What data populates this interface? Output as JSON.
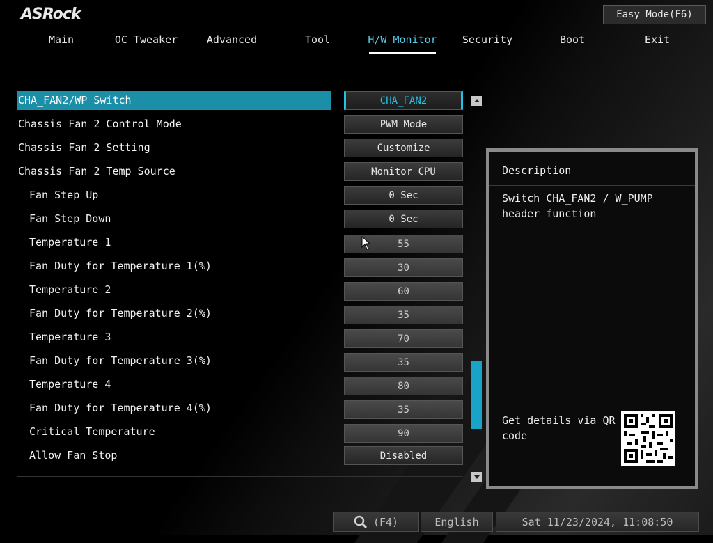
{
  "brand": {
    "logo": "ASRock"
  },
  "header": {
    "easy_mode_label": "Easy Mode(F6)"
  },
  "nav": {
    "tabs": [
      {
        "label": "Main"
      },
      {
        "label": "OC Tweaker"
      },
      {
        "label": "Advanced"
      },
      {
        "label": "Tool"
      },
      {
        "label": "H/W Monitor",
        "active": true
      },
      {
        "label": "Security"
      },
      {
        "label": "Boot"
      },
      {
        "label": "Exit"
      }
    ]
  },
  "settings": [
    {
      "label": "CHA_FAN2/WP Switch",
      "value": "CHA_FAN2",
      "selected": true
    },
    {
      "label": "Chassis Fan 2 Control Mode",
      "value": "PWM Mode"
    },
    {
      "label": "Chassis Fan 2 Setting",
      "value": "Customize"
    },
    {
      "label": "Chassis Fan 2 Temp Source",
      "value": "Monitor CPU"
    },
    {
      "label": "Fan Step Up",
      "value": "0 Sec"
    },
    {
      "label": "Fan Step Down",
      "value": "0 Sec"
    },
    {
      "label": "Temperature 1",
      "value": "55"
    },
    {
      "label": "Fan Duty for Temperature 1(%)",
      "value": "30"
    },
    {
      "label": "Temperature 2",
      "value": "60"
    },
    {
      "label": "Fan Duty for Temperature 2(%)",
      "value": "35"
    },
    {
      "label": "Temperature 3",
      "value": "70"
    },
    {
      "label": "Fan Duty for Temperature 3(%)",
      "value": "35"
    },
    {
      "label": "Temperature 4",
      "value": "80"
    },
    {
      "label": "Fan Duty for Temperature 4(%)",
      "value": "35"
    },
    {
      "label": "Critical Temperature",
      "value": "90"
    },
    {
      "label": "Allow Fan Stop",
      "value": "Disabled"
    }
  ],
  "description": {
    "title": "Description",
    "text": "Switch CHA_FAN2 / W_PUMP header function",
    "qr_text": "Get details via QR code"
  },
  "footer": {
    "search_key": "(F4)",
    "language": "English",
    "datetime": "Sat 11/23/2024, 11:08:50"
  },
  "colors": {
    "accent": "#22c3e6",
    "highlight": "#1b8fa8",
    "active_tab": "#58c8e8"
  },
  "icons": [
    "search-icon",
    "scroll-up-icon",
    "scroll-down-icon",
    "qr-code-icon",
    "mouse-cursor-icon"
  ]
}
